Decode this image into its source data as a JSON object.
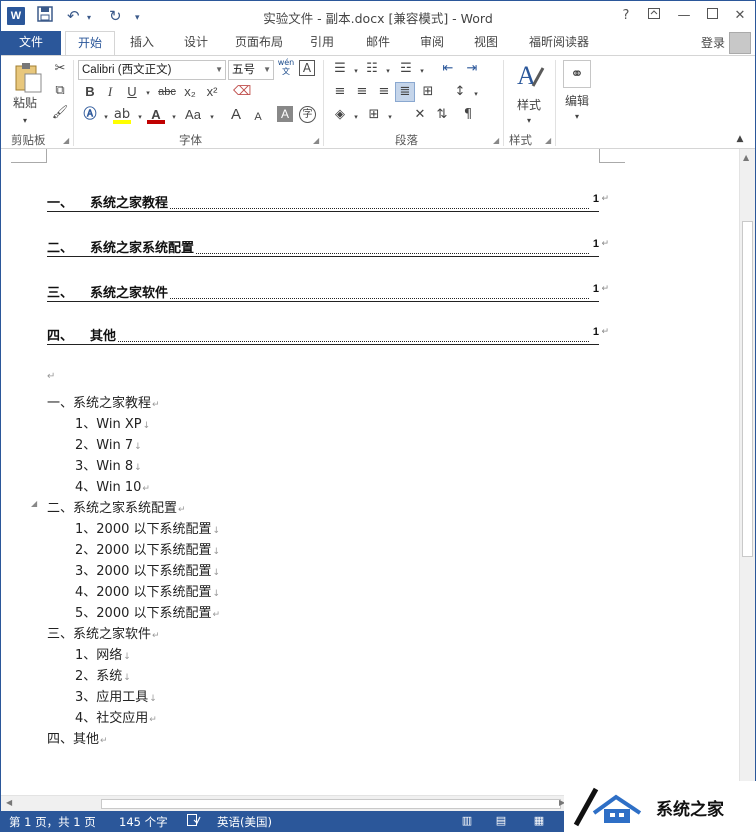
{
  "titlebar": {
    "title": "实验文件 - 副本.docx [兼容模式] - Word",
    "help": "?",
    "minimize": "—",
    "close": "✕"
  },
  "tabs": [
    "文件",
    "开始",
    "插入",
    "设计",
    "页面布局",
    "引用",
    "邮件",
    "审阅",
    "视图",
    "福昕阅读器"
  ],
  "login": "登录",
  "ribbon": {
    "clipboard": {
      "paste": "粘贴",
      "label": "剪贴板"
    },
    "font": {
      "name": "Calibri (西文正文)",
      "size": "五号",
      "label": "字体",
      "bold": "B",
      "italic": "I",
      "underline": "U",
      "strike": "abc",
      "sub": "x₂",
      "sup": "x²",
      "grow": "A",
      "shrink": "A",
      "case": "Aa",
      "wen": "wén\n文",
      "A_box": "A",
      "zi": "字"
    },
    "paragraph": {
      "label": "段落"
    },
    "styles": {
      "label": "样式",
      "button": "样式"
    },
    "editing": {
      "button": "编辑"
    }
  },
  "toc": [
    {
      "num": "一、",
      "label": "系统之家教程",
      "page": "1"
    },
    {
      "num": "二、",
      "label": "系统之家系统配置",
      "page": "1"
    },
    {
      "num": "三、",
      "label": "系统之家软件",
      "page": "1"
    },
    {
      "num": "四、",
      "label": "其他",
      "page": "1"
    }
  ],
  "body": {
    "empty_mark": "↵",
    "lines": [
      {
        "text": "一、系统之家教程",
        "mark": "↵"
      },
      {
        "text": "1、Win XP",
        "mark": "↓"
      },
      {
        "text": "2、Win 7",
        "mark": "↓"
      },
      {
        "text": "3、Win 8",
        "mark": "↓"
      },
      {
        "text": "4、Win 10",
        "mark": "↵"
      },
      {
        "text": "二、系统之家系统配置",
        "mark": "↵"
      },
      {
        "text": "1、2000 以下系统配置",
        "mark": "↓"
      },
      {
        "text": "2、2000 以下系统配置",
        "mark": "↓"
      },
      {
        "text": "3、2000 以下系统配置",
        "mark": "↓"
      },
      {
        "text": "4、2000 以下系统配置",
        "mark": "↓"
      },
      {
        "text": "5、2000 以下系统配置",
        "mark": "↵"
      },
      {
        "text": "三、系统之家软件",
        "mark": "↵"
      },
      {
        "text": "1、网络",
        "mark": "↓"
      },
      {
        "text": "2、系统",
        "mark": "↓"
      },
      {
        "text": "3、应用工具",
        "mark": "↓"
      },
      {
        "text": "4、社交应用",
        "mark": "↵"
      },
      {
        "text": "四、其他",
        "mark": "↵"
      }
    ]
  },
  "status": {
    "page": "第 1 页，共 1 页",
    "words": "145 个字",
    "language": "英语(美国)"
  },
  "watermark": "系统之家",
  "colors": {
    "accent": "#2b579a"
  }
}
